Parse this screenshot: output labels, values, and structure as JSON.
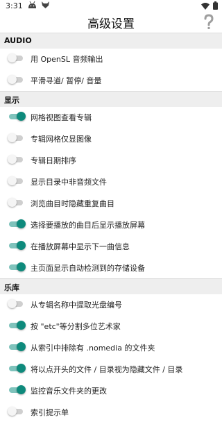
{
  "status_bar": {
    "time": "3:31"
  },
  "app_bar": {
    "title": "高级设置"
  },
  "sections": [
    {
      "header": "AUDIO",
      "items": [
        {
          "label": "用 OpenSL 音频输出",
          "checked": false
        },
        {
          "label": "平滑寻道/ 暂停/ 音量",
          "checked": false
        }
      ]
    },
    {
      "header": "显示",
      "items": [
        {
          "label": "网格视图查看专辑",
          "checked": true
        },
        {
          "label": "专辑网格仅显图像",
          "checked": false
        },
        {
          "label": "专辑日期排序",
          "checked": false
        },
        {
          "label": "显示目录中非音频文件",
          "checked": false
        },
        {
          "label": "浏览曲目时隐藏重复曲目",
          "checked": false
        },
        {
          "label": "选择要播放的曲目后显示播放屏幕",
          "checked": true
        },
        {
          "label": "在播放屏幕中显示下一曲信息",
          "checked": true
        },
        {
          "label": "主页面显示自动检测到的存储设备",
          "checked": true
        }
      ]
    },
    {
      "header": "乐库",
      "items": [
        {
          "label": "从专辑名称中提取光盘编号",
          "checked": false
        },
        {
          "label": "按 \"etc\"等分割多位艺术家",
          "checked": true
        },
        {
          "label": "从索引中排除有 .nomedia 的文件夹",
          "checked": true
        },
        {
          "label": "将以点开头的文件 / 目录视为隐藏文件 / 目录",
          "checked": true
        },
        {
          "label": "监控音乐文件夹的更改",
          "checked": true
        },
        {
          "label": "索引提示单",
          "checked": false
        }
      ]
    }
  ],
  "colors": {
    "accent": "#0e8a7c",
    "header_bg": "#eeeeee"
  },
  "icons": {
    "help": "question-mark-icon"
  }
}
